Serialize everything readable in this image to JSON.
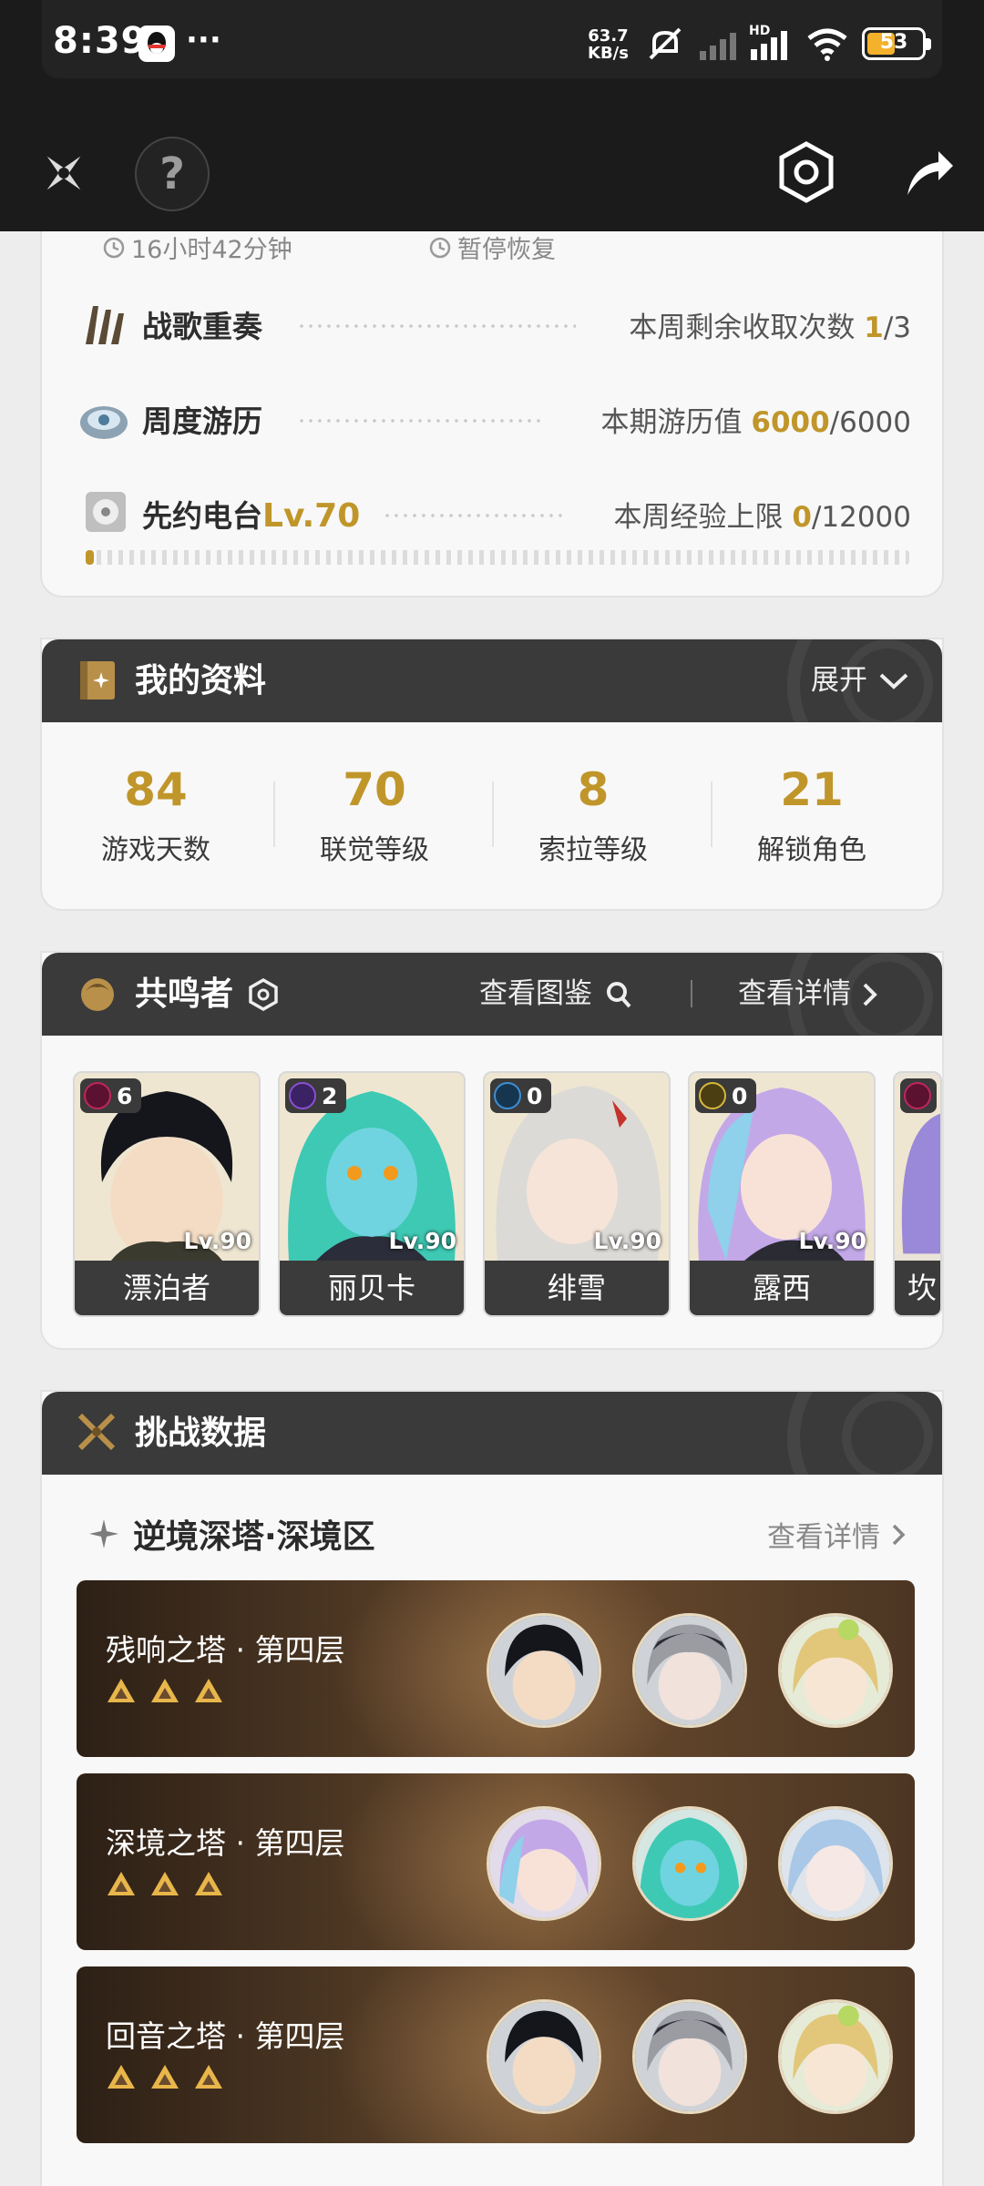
{
  "status_bar": {
    "time": "8:39",
    "net_speed_value": "63.7",
    "net_speed_unit": "KB/s",
    "network_type": "HD",
    "battery": "53"
  },
  "resources": {
    "items": [
      {
        "icon": "war-song-icon",
        "label": "战歌重奏",
        "desc": "本周剩余收取次数",
        "current": "1",
        "total": "/3"
      },
      {
        "icon": "weekly-travel-icon",
        "label": "周度游历",
        "desc": "本期游历值",
        "current": "6000",
        "total": "/6000"
      },
      {
        "icon": "radio-icon",
        "label": "先约电台",
        "level": "Lv.70",
        "desc": "本周经验上限",
        "current": "0",
        "total": "/12000"
      }
    ],
    "timers": [
      {
        "icon": "clock-icon",
        "text": "16小时42分钟"
      },
      {
        "icon": "clock-icon",
        "text": "暂停恢复"
      }
    ],
    "radio_progress": 0.01
  },
  "profile": {
    "title": "我的资料",
    "expand_label": "展开",
    "stats": [
      {
        "value": "84",
        "label": "游戏天数"
      },
      {
        "value": "70",
        "label": "联觉等级"
      },
      {
        "value": "8",
        "label": "索拉等级"
      },
      {
        "value": "21",
        "label": "解锁角色"
      }
    ]
  },
  "resonators": {
    "title": "共鸣者",
    "view_catalog_label": "查看图鉴",
    "view_details_label": "查看详情",
    "characters": [
      {
        "name": "漂泊者",
        "level": "Lv.90",
        "chain": "6",
        "element": "havoc",
        "element_color": "#c2255c"
      },
      {
        "name": "丽贝卡",
        "level": "Lv.90",
        "chain": "2",
        "element": "electro",
        "element_color": "#8a4fd4"
      },
      {
        "name": "绯雪",
        "level": "Lv.90",
        "chain": "0",
        "element": "glacio",
        "element_color": "#3c8fd6"
      },
      {
        "name": "露西",
        "level": "Lv.90",
        "chain": "0",
        "element": "spectro",
        "element_color": "#d6b73c"
      },
      {
        "name": "坎",
        "level": "",
        "chain": "",
        "element": "havoc",
        "element_color": "#c2255c"
      }
    ]
  },
  "challenge": {
    "title": "挑战数据",
    "sub_title": "逆境深塔·深境区",
    "details_label": "查看详情",
    "towers": [
      {
        "name": "残响之塔 · 第四层",
        "stars": 3
      },
      {
        "name": "深境之塔 · 第四层",
        "stars": 3
      },
      {
        "name": "回音之塔 · 第四层",
        "stars": 3
      }
    ]
  }
}
